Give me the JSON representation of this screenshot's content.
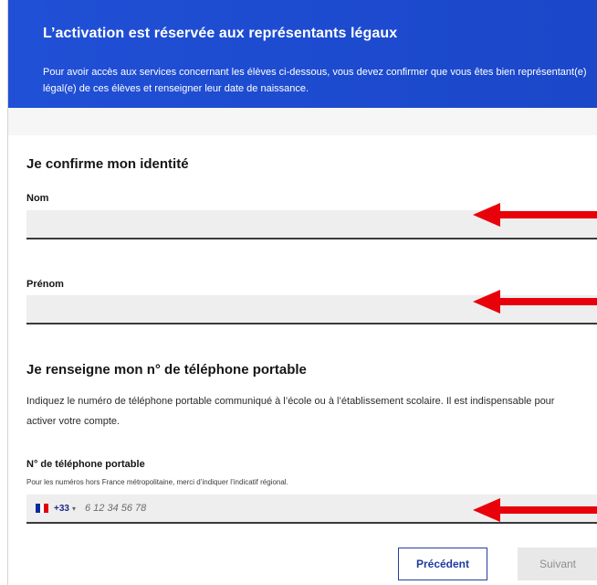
{
  "banner": {
    "title": "L’activation est réservée aux représentants légaux",
    "text": "Pour avoir accès aux services concernant les élèves ci-dessous, vous devez confirmer que vous êtes bien représentant(e) légal(e) de ces élèves et renseigner leur date de naissance."
  },
  "identity": {
    "title": "Je confirme mon identité",
    "nom_label": "Nom",
    "prenom_label": "Prénom"
  },
  "phone_section": {
    "title": "Je renseigne mon n° de téléphone portable",
    "help": "Indiquez le numéro de téléphone portable communiqué à l’école ou à l’établissement scolaire. Il est indispensable pour activer votre compte.",
    "label": "N° de téléphone portable",
    "hint": "Pour les numéros hors France métropolitaine, merci d’indiquer l’indicatif régional.",
    "dial_code": "+33",
    "placeholder": "6 12 34 56 78",
    "flag_colors": [
      "#0f2a9c",
      "#ffffff",
      "#e1000f"
    ]
  },
  "buttons": {
    "previous": "Précédent",
    "next": "Suivant"
  },
  "annotation_color": "#e8000b"
}
